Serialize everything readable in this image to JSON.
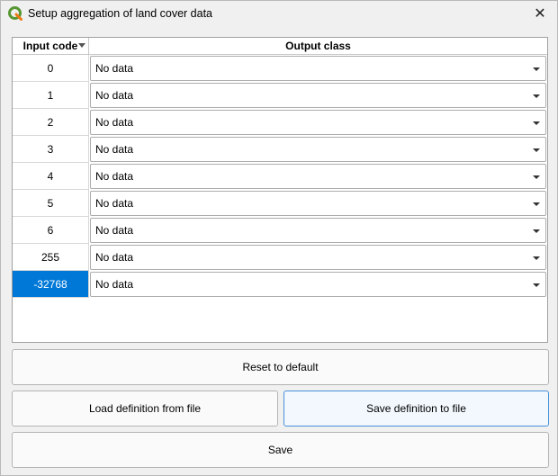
{
  "window": {
    "title": "Setup aggregation of land cover data",
    "close_icon": "close-icon",
    "app_icon": "qgis-icon",
    "accent": "#0078d7",
    "app_icon_color": "#589632"
  },
  "table": {
    "headers": {
      "input_code": "Input code",
      "output_class": "Output class"
    },
    "rows": [
      {
        "code": "0",
        "output": "No data"
      },
      {
        "code": "1",
        "output": "No data"
      },
      {
        "code": "2",
        "output": "No data"
      },
      {
        "code": "3",
        "output": "No data"
      },
      {
        "code": "4",
        "output": "No data"
      },
      {
        "code": "5",
        "output": "No data"
      },
      {
        "code": "6",
        "output": "No data"
      },
      {
        "code": "255",
        "output": "No data"
      },
      {
        "code": "-32768",
        "output": "No data",
        "selected": true
      }
    ]
  },
  "buttons": {
    "reset": "Reset to default",
    "load": "Load definition from file",
    "save_definition": "Save definition to file",
    "save": "Save"
  }
}
